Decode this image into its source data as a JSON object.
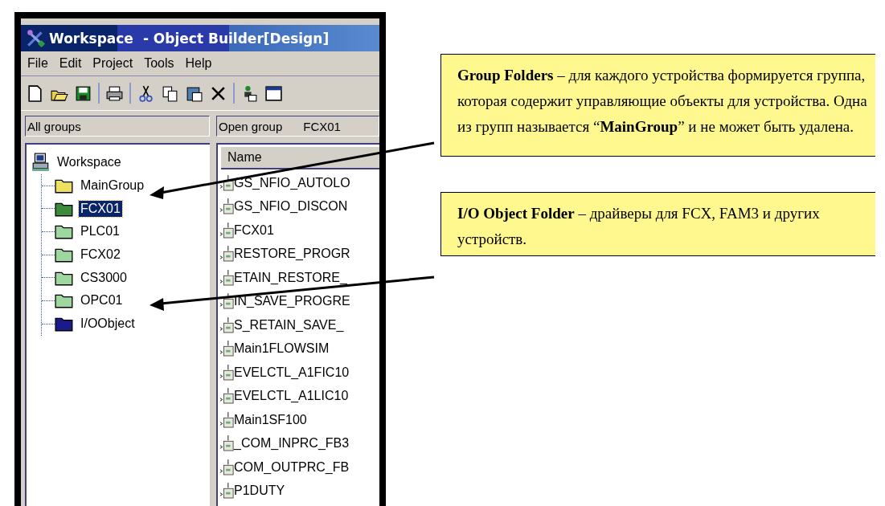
{
  "window": {
    "title": "Workspace",
    "title_rest": "- Object Builder[Design]"
  },
  "menu": [
    "File",
    "Edit",
    "Project",
    "Tools",
    "Help"
  ],
  "groups_panel": {
    "header": "All groups",
    "root": "Workspace",
    "children": [
      {
        "label": "MainGroup",
        "color": "#f0e060",
        "selected": false
      },
      {
        "label": "FCX01",
        "color": "#3c8a3c",
        "selected": true
      },
      {
        "label": "PLC01",
        "color": "#9fd89f",
        "selected": false
      },
      {
        "label": "FCX02",
        "color": "#9fd89f",
        "selected": false
      },
      {
        "label": "CS3000",
        "color": "#9fd89f",
        "selected": false
      },
      {
        "label": "OPC01",
        "color": "#9fd89f",
        "selected": false
      },
      {
        "label": "I/OObject",
        "color": "#1a1a8c",
        "selected": false
      }
    ]
  },
  "objects_panel": {
    "header": "Open group",
    "group": "FCX01",
    "column": "Name",
    "rows": [
      "GS_NFIO_AUTOLO",
      "GS_NFIO_DISCON",
      "FCX01",
      "RESTORE_PROGR",
      "ETAIN_RESTORE_",
      "IN_SAVE_PROGRE",
      "S_RETAIN_SAVE_",
      "Main1FLOWSIM",
      "EVELCTL_A1FIC10",
      "EVELCTL_A1LIC10",
      "Main1SF100",
      "_COM_INPRC_FB3",
      "COM_OUTPRC_FB",
      "P1DUTY"
    ]
  },
  "callouts": [
    {
      "text": "**Group Folders** – для каждого устройства формируется группа, которая содержит управляющие объекты для устройства. Одна из групп называется “**MainGroup**” и не может быть удалена."
    },
    {
      "text": "**I/O Object Folder** – драйверы для FCX, FAM3 и других устройств."
    }
  ]
}
